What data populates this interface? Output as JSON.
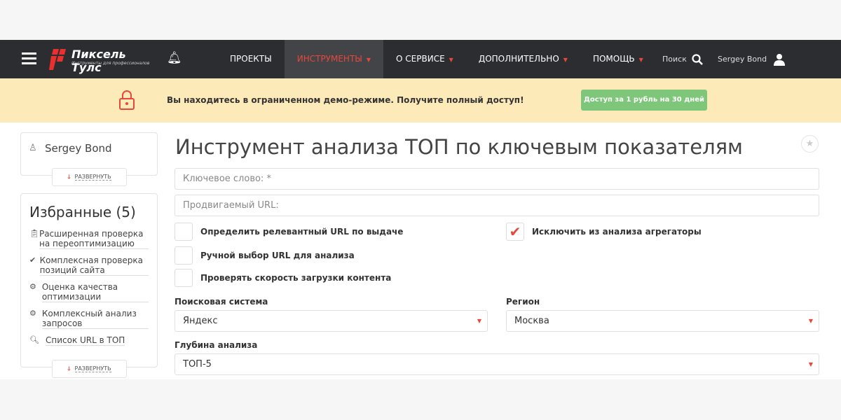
{
  "header": {
    "logo_title": "Пиксель Тулс",
    "logo_subtitle": "Инструменты для профессионалов",
    "nav": [
      {
        "label": "ПРОЕКТЫ"
      },
      {
        "label": "ИНСТРУМЕНТЫ"
      },
      {
        "label": "О СЕРВИСЕ"
      },
      {
        "label": "ДОПОЛНИТЕЛЬНО"
      },
      {
        "label": "ПОМОЩЬ"
      }
    ],
    "search_label": "Поиск",
    "user_name": "Sergey Bond"
  },
  "banner": {
    "message": "Вы находитесь в ограниченном демо-режиме. Получите полный доступ!",
    "button": "Доступ за 1 рубль на 30 дней"
  },
  "sidebar": {
    "user_name": "Sergey Bond",
    "expand": "РАЗВЕРНУТЬ",
    "favorites_title": "Избранные (5)",
    "favorites": [
      {
        "label": "Расширенная проверка на переоптимизацию"
      },
      {
        "label": "Комплексная проверка позиций сайта"
      },
      {
        "label": "Оценка качества оптимизации"
      },
      {
        "label": "Комплексный анализ запросов"
      },
      {
        "label": "Список URL в ТОП"
      }
    ]
  },
  "main": {
    "title": "Инструмент анализа ТОП по ключевым показателям",
    "keyword_placeholder": "Ключевое слово: *",
    "url_placeholder": "Продвигаемый URL:",
    "checkboxes": [
      {
        "label": "Определить релевантный URL по выдаче",
        "checked": false
      },
      {
        "label": "Ручной выбор URL для анализа",
        "checked": false
      },
      {
        "label": "Проверять скорость загрузки контента",
        "checked": false
      },
      {
        "label": "Исключить из анализа агрегаторы",
        "checked": true
      }
    ],
    "search_engine_label": "Поисковая система",
    "search_engine": "Яндекс",
    "region_label": "Регион",
    "region": "Москва",
    "depth_label": "Глубина анализа",
    "depth": "ТОП-5"
  }
}
